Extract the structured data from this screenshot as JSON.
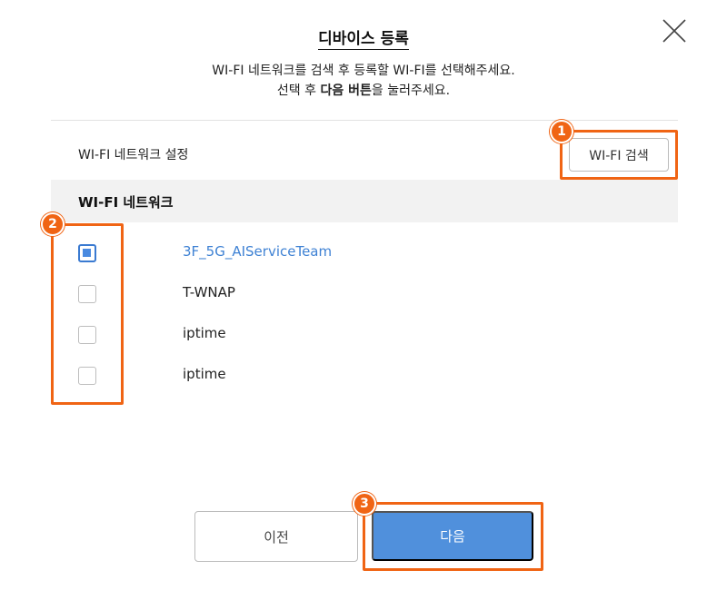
{
  "dialog": {
    "title": "디바이스 등록",
    "desc_line1": "WI-FI 네트워크를 검색 후 등록할 WI-FI를 선택해주세요.",
    "desc_line2_pre": "선택 후 ",
    "desc_line2_bold": "다음 버튼",
    "desc_line2_post": "을 눌러주세요."
  },
  "settings": {
    "label": "WI-FI 네트워크 설정",
    "search_button": "WI-FI 검색"
  },
  "network_list": {
    "header": "WI-FI 네트워크",
    "items": [
      {
        "name": "3F_5G_AIServiceTeam",
        "checked": true
      },
      {
        "name": "T-WNAP",
        "checked": false
      },
      {
        "name": "iptime",
        "checked": false
      },
      {
        "name": "iptime",
        "checked": false
      }
    ]
  },
  "annotations": [
    "1",
    "2",
    "3"
  ],
  "buttons": {
    "prev": "이전",
    "next": "다음"
  },
  "colors": {
    "accent": "#5090dc",
    "annotation": "#f06414",
    "selected_text": "#3f82d4"
  }
}
